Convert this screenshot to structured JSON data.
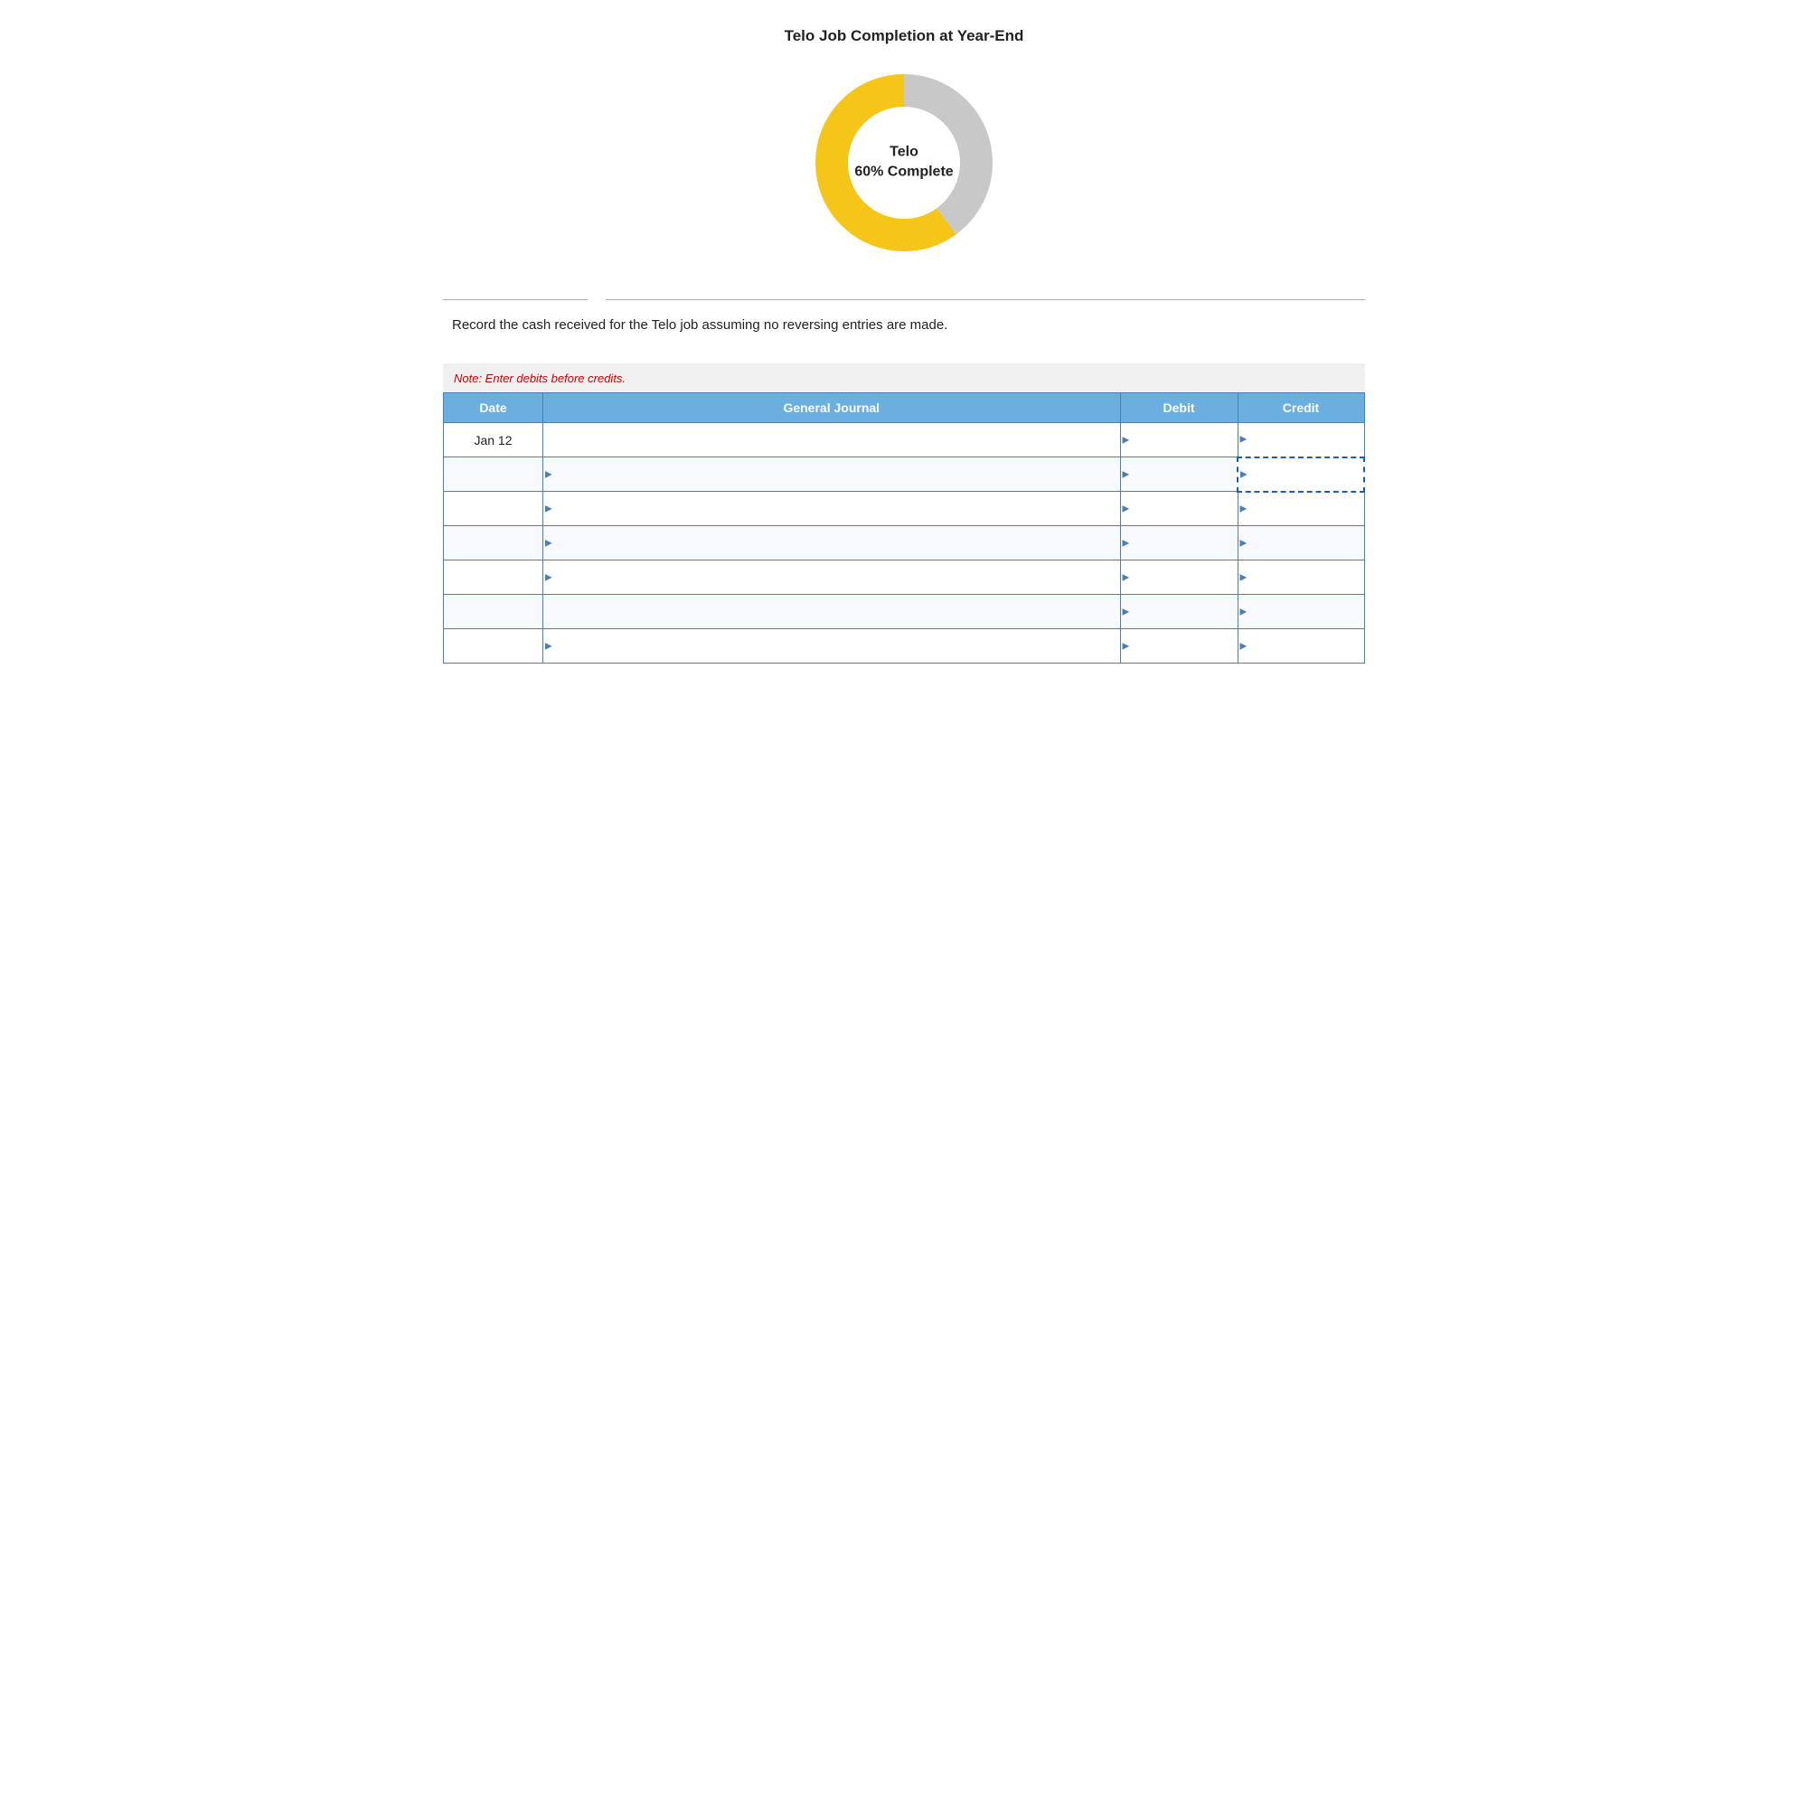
{
  "chart": {
    "title": "Telo Job Completion at Year-End",
    "center_line1": "Telo",
    "center_line2": "60% Complete",
    "completion_pct": 60,
    "color_complete": "#F5C518",
    "color_incomplete": "#C8C8C8"
  },
  "dividers": {},
  "instruction": {
    "text": "Record the cash received for the Telo job assuming no reversing entries are made."
  },
  "note": {
    "text": "Note: Enter debits before credits."
  },
  "table": {
    "headers": {
      "date": "Date",
      "journal": "General Journal",
      "debit": "Debit",
      "credit": "Credit"
    },
    "rows": [
      {
        "date": "Jan 12",
        "journal": "",
        "debit": "",
        "credit": "",
        "indent": false,
        "credit_selected": false
      },
      {
        "date": "",
        "journal": "",
        "debit": "",
        "credit": "",
        "indent": true,
        "credit_selected": true
      },
      {
        "date": "",
        "journal": "",
        "debit": "",
        "credit": "",
        "indent": true,
        "credit_selected": false
      },
      {
        "date": "",
        "journal": "",
        "debit": "",
        "credit": "",
        "indent": true,
        "credit_selected": false
      },
      {
        "date": "",
        "journal": "",
        "debit": "",
        "credit": "",
        "indent": true,
        "credit_selected": false
      },
      {
        "date": "",
        "journal": "",
        "debit": "",
        "credit": "",
        "indent": false,
        "credit_selected": false
      },
      {
        "date": "",
        "journal": "",
        "debit": "",
        "credit": "",
        "indent": true,
        "credit_selected": false
      }
    ]
  }
}
